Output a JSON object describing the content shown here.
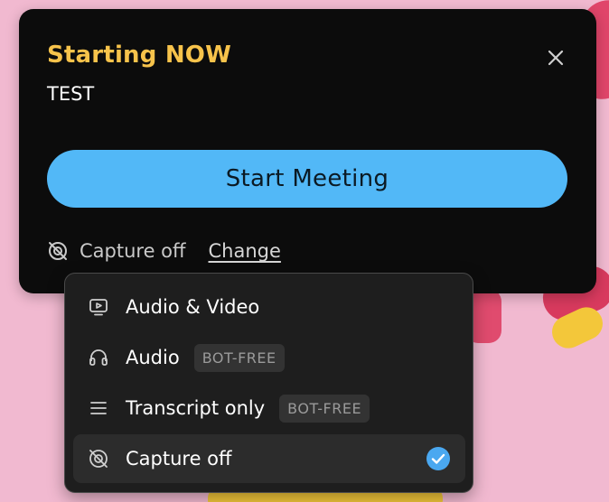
{
  "card": {
    "title": "Starting NOW",
    "subtitle": "TEST",
    "start_button_label": "Start Meeting",
    "capture_status": "Capture off",
    "change_link": "Change"
  },
  "menu": {
    "items": [
      {
        "label": "Audio & Video",
        "icon": "video-screen-icon"
      },
      {
        "label": "Audio",
        "icon": "headphones-icon",
        "badge": "BOT-FREE"
      },
      {
        "label": "Transcript only",
        "icon": "lines-icon",
        "badge": "BOT-FREE"
      },
      {
        "label": "Capture off",
        "icon": "capture-off-icon",
        "selected": true
      }
    ]
  },
  "colors": {
    "title_accent": "#f7c34b",
    "primary_button": "#52b8f7",
    "card_background": "#0c0c0c",
    "menu_background": "#1e1e1e",
    "check_color": "#4aa8f0"
  }
}
